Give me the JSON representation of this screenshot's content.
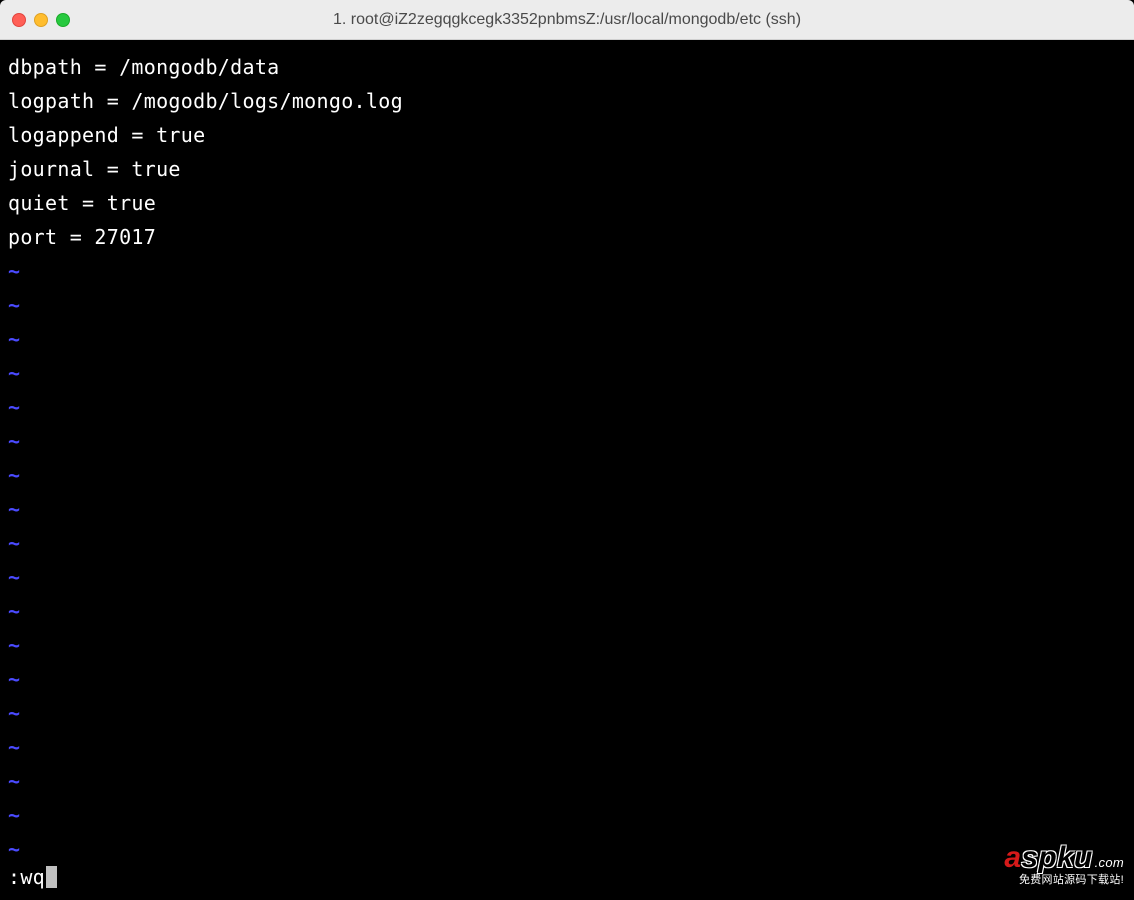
{
  "window": {
    "title": "1. root@iZ2zegqgkcegk3352pnbmsZ:/usr/local/mongodb/etc (ssh)"
  },
  "editor": {
    "lines": [
      "dbpath = /mongodb/data",
      "logpath = /mogodb/logs/mongo.log",
      "logappend = true",
      "journal = true",
      "quiet = true",
      "port = 27017"
    ],
    "tilde": "~",
    "tilde_count": 18,
    "command": ":wq"
  },
  "watermark": {
    "brand_a": "a",
    "brand_spku": "spku",
    "brand_com": ".com",
    "tagline": "免费网站源码下载站!"
  }
}
